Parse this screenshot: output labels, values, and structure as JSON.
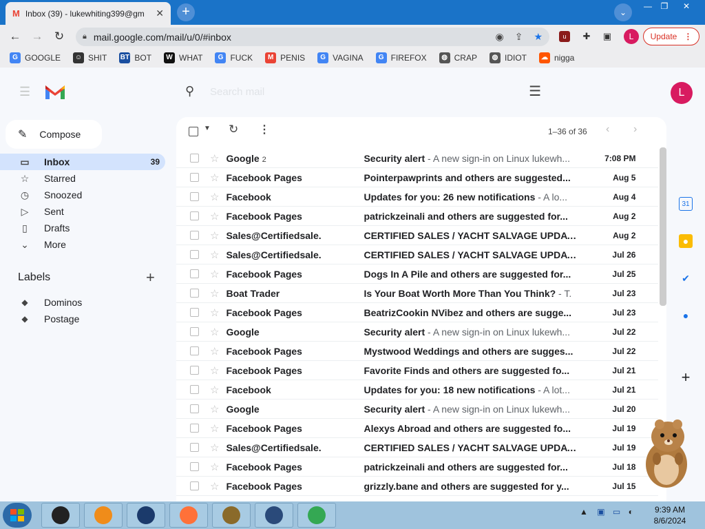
{
  "browser": {
    "tab_title": "Inbox (39) - lukewhiting399@gm",
    "tab_close": "✕",
    "new_tab": "+",
    "tab_search": "⌄",
    "window_controls": {
      "minimize": "—",
      "restore": "❐",
      "close": "✕"
    },
    "url": "mail.google.com/mail/u/0/#inbox",
    "profile_letter": "L",
    "update_label": "Update",
    "bookmarks": [
      {
        "label": "GOOGLE",
        "icon": "google-icon",
        "color": "#4285f4",
        "glyph": "G"
      },
      {
        "label": "SHIT",
        "icon": "face-icon",
        "color": "#333333",
        "glyph": "☺"
      },
      {
        "label": "BOT",
        "icon": "bt-icon",
        "color": "#1a4fa0",
        "glyph": "BT"
      },
      {
        "label": "WHAT",
        "icon": "w-icon",
        "color": "#111111",
        "glyph": "W"
      },
      {
        "label": "FUCK",
        "icon": "google-icon",
        "color": "#4285f4",
        "glyph": "G"
      },
      {
        "label": "PENIS",
        "icon": "gmail-icon",
        "color": "#ea4335",
        "glyph": "M"
      },
      {
        "label": "VAGINA",
        "icon": "google-icon",
        "color": "#4285f4",
        "glyph": "G"
      },
      {
        "label": "FIREFOX",
        "icon": "google-icon",
        "color": "#4285f4",
        "glyph": "G"
      },
      {
        "label": "CRAP",
        "icon": "globe-icon",
        "color": "#555555",
        "glyph": "◍"
      },
      {
        "label": "IDIOT",
        "icon": "globe-icon",
        "color": "#555555",
        "glyph": "◍"
      },
      {
        "label": "nigga",
        "icon": "soundcloud-icon",
        "color": "#ff5500",
        "glyph": "☁"
      }
    ]
  },
  "gmail": {
    "search_placeholder": "Search mail",
    "compose_label": "Compose",
    "avatar_letter": "L",
    "nav": [
      {
        "label": "Inbox",
        "icon": "inbox-icon",
        "glyph": "▭",
        "count": "39",
        "active": true
      },
      {
        "label": "Starred",
        "icon": "star-icon",
        "glyph": "☆",
        "count": ""
      },
      {
        "label": "Snoozed",
        "icon": "clock-icon",
        "glyph": "◷",
        "count": ""
      },
      {
        "label": "Sent",
        "icon": "send-icon",
        "glyph": "▷",
        "count": ""
      },
      {
        "label": "Drafts",
        "icon": "file-icon",
        "glyph": "▯",
        "count": ""
      },
      {
        "label": "More",
        "icon": "chevron-down-icon",
        "glyph": "⌄",
        "count": ""
      }
    ],
    "labels_title": "Labels",
    "labels_add": "+",
    "labels": [
      {
        "label": "Dominos"
      },
      {
        "label": "Postage"
      }
    ],
    "pagination": "1–36 of 36",
    "emails": [
      {
        "from": "Google",
        "count": "2",
        "subject": "Security alert",
        "snippet": " - A new sign-in on Linux lukewh...",
        "date": "7:08 PM"
      },
      {
        "from": "Facebook Pages",
        "count": "",
        "subject": "Pointerpawprints and others are suggested...",
        "snippet": "",
        "date": "Aug 5"
      },
      {
        "from": "Facebook",
        "count": "",
        "subject": "Updates for you: 26 new notifications",
        "snippet": " - A lo...",
        "date": "Aug 4"
      },
      {
        "from": "Facebook Pages",
        "count": "",
        "subject": "patrickzeinali and others are suggested for...",
        "snippet": "",
        "date": "Aug 2"
      },
      {
        "from": "Sales@Certifiedsale.",
        "count": "",
        "subject": "CERTIFIED SALES / YACHT SALVAGE UPDAT...",
        "snippet": "",
        "date": "Aug 2"
      },
      {
        "from": "Sales@Certifiedsale.",
        "count": "",
        "subject": "CERTIFIED SALES / YACHT SALVAGE UPDAT...",
        "snippet": "",
        "date": "Jul 26"
      },
      {
        "from": "Facebook Pages",
        "count": "",
        "subject": "Dogs In A Pile and others are suggested for...",
        "snippet": "",
        "date": "Jul 25"
      },
      {
        "from": "Boat Trader",
        "count": "",
        "subject": "Is Your Boat Worth More Than You Think?",
        "snippet": " - T.",
        "date": "Jul 23"
      },
      {
        "from": "Facebook Pages",
        "count": "",
        "subject": "BeatrizCookin NVibez and others are sugge...",
        "snippet": "",
        "date": "Jul 23"
      },
      {
        "from": "Google",
        "count": "",
        "subject": "Security alert",
        "snippet": " - A new sign-in on Linux lukewh...",
        "date": "Jul 22"
      },
      {
        "from": "Facebook Pages",
        "count": "",
        "subject": "Mystwood Weddings and others are sugges...",
        "snippet": "",
        "date": "Jul 22"
      },
      {
        "from": "Facebook Pages",
        "count": "",
        "subject": "Favorite Finds and others are suggested fo...",
        "snippet": "",
        "date": "Jul 21"
      },
      {
        "from": "Facebook",
        "count": "",
        "subject": "Updates for you: 18 new notifications",
        "snippet": " - A lot...",
        "date": "Jul 21"
      },
      {
        "from": "Google",
        "count": "",
        "subject": "Security alert",
        "snippet": " - A new sign-in on Linux lukewh...",
        "date": "Jul 20"
      },
      {
        "from": "Facebook Pages",
        "count": "",
        "subject": "Alexys Abroad and others are suggested fo...",
        "snippet": "",
        "date": "Jul 19"
      },
      {
        "from": "Sales@Certifiedsale.",
        "count": "",
        "subject": "CERTIFIED SALES / YACHT SALVAGE UPDAT...",
        "snippet": "",
        "date": "Jul 19"
      },
      {
        "from": "Facebook Pages",
        "count": "",
        "subject": "patrickzeinali and others are suggested for...",
        "snippet": "",
        "date": "Jul 18"
      },
      {
        "from": "Facebook Pages",
        "count": "",
        "subject": "grizzly.bane and others are suggested for y...",
        "snippet": "",
        "date": "Jul 15"
      }
    ]
  },
  "taskbar": {
    "time": "9:39 AM",
    "date": "8/6/2024",
    "apps": [
      {
        "name": "app-black-box",
        "color": "#222222"
      },
      {
        "name": "app-media-player",
        "color": "#f08c1a"
      },
      {
        "name": "app-globe",
        "color": "#1b3a6b"
      },
      {
        "name": "app-firefox",
        "color": "#ff7139"
      },
      {
        "name": "app-game-box",
        "color": "#8a6a2a"
      },
      {
        "name": "app-counter-strike",
        "color": "#2a4a7a"
      },
      {
        "name": "app-chrome",
        "color": "#34a853"
      }
    ]
  },
  "colors": {
    "accent": "#1a73c8",
    "gmail_red": "#ea4335",
    "inbox_active": "#d3e3fd"
  }
}
